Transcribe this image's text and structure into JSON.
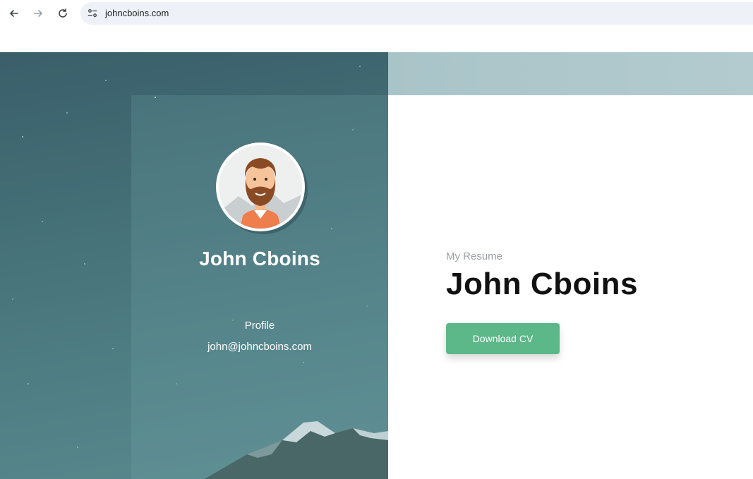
{
  "browser": {
    "url": "johncboins.com",
    "icons": {
      "back": "arrow-left-icon",
      "forward": "arrow-right-icon",
      "reload": "reload-icon",
      "site_info": "tune-icon"
    }
  },
  "profile_card": {
    "avatar_icon": "bearded-man-avatar",
    "name": "John Cboins",
    "role": "Profile",
    "email": "john@johncboins.com"
  },
  "hero": {
    "label": "My Resume",
    "name": "John Cboins",
    "download_button": "Download CV"
  },
  "colors": {
    "accent": "#5cb888",
    "left_panel": "#446f77",
    "header_strip": "#aec7cb"
  }
}
